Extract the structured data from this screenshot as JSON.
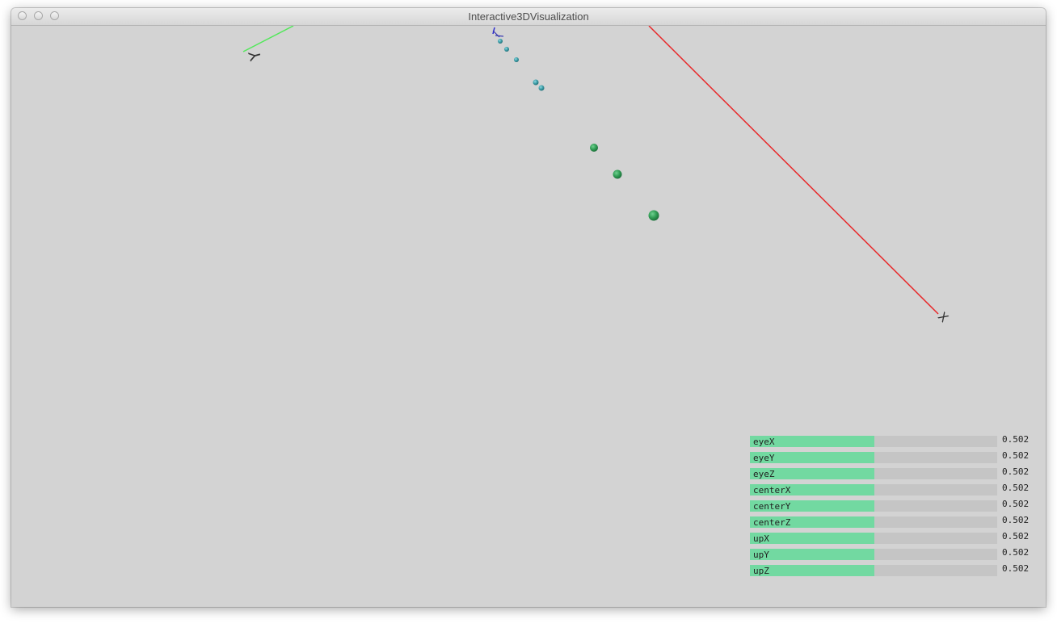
{
  "window": {
    "title": "Interactive3DVisualization"
  },
  "scene": {
    "axis_labels": {
      "x": "X",
      "y": "Y"
    },
    "colors": {
      "x_axis": "#e8282a",
      "y_axis": "#52e85a",
      "z_axis": "#2a2ad0",
      "point_green": "#2f9b53",
      "point_teal": "#3a9aa4",
      "background": "#d3d3d3"
    }
  },
  "controls": {
    "sliders": [
      {
        "label": "eyeX",
        "value": "0.502",
        "fraction": 0.502
      },
      {
        "label": "eyeY",
        "value": "0.502",
        "fraction": 0.502
      },
      {
        "label": "eyeZ",
        "value": "0.502",
        "fraction": 0.502
      },
      {
        "label": "centerX",
        "value": "0.502",
        "fraction": 0.502
      },
      {
        "label": "centerY",
        "value": "0.502",
        "fraction": 0.502
      },
      {
        "label": "centerZ",
        "value": "0.502",
        "fraction": 0.502
      },
      {
        "label": "upX",
        "value": "0.502",
        "fraction": 0.502
      },
      {
        "label": "upY",
        "value": "0.502",
        "fraction": 0.502
      },
      {
        "label": "upZ",
        "value": "0.502",
        "fraction": 0.502
      }
    ],
    "colors": {
      "fill": "#72d9a1",
      "track": "#c5c5c5"
    }
  }
}
